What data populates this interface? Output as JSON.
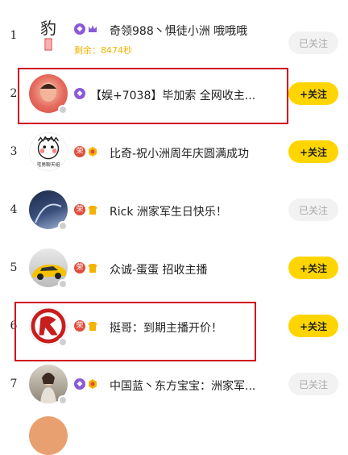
{
  "rows": [
    {
      "rank": "1",
      "name": "奇领988丶惧徒小洲 哦哦哦",
      "sub": "剩余：8474秒",
      "button": "已关注"
    },
    {
      "rank": "2",
      "name": "【娱+7038】毕加索 全网收主...",
      "button": "+关注"
    },
    {
      "rank": "3",
      "name": "比奇-祝小洲周年庆圆满成功",
      "button": "+关注"
    },
    {
      "rank": "4",
      "name": "Rick 洲家军生日快乐！",
      "button": "已关注"
    },
    {
      "rank": "5",
      "name": "众诚-蛋蛋 招收主播",
      "button": "+关注"
    },
    {
      "rank": "6",
      "name": "挺哥：到期主播开价！",
      "button": "+关注"
    },
    {
      "rank": "7",
      "name": "中国蓝丶东方宝宝：洲家军...",
      "button": "已关注"
    }
  ],
  "avatar1_text": "豹",
  "avatar3_text": "宅男聊天组",
  "badge_red_label": "荣",
  "colors": {
    "follow": "#ffd500",
    "highlight": "#d0021b",
    "countdown": "#f0b400"
  }
}
